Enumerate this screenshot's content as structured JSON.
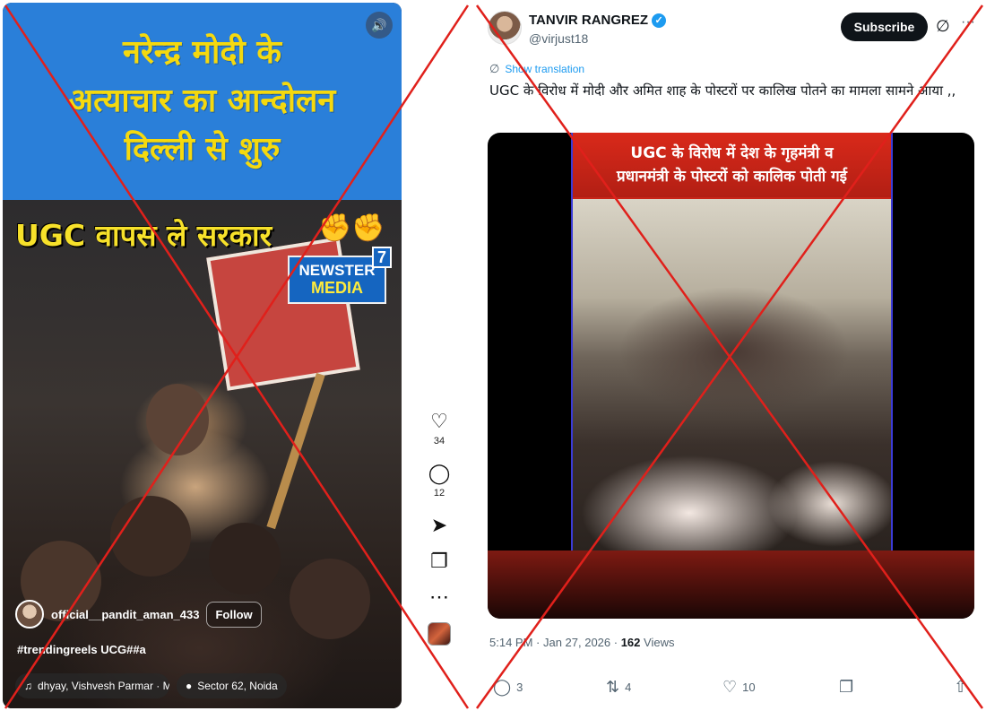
{
  "reel": {
    "banner_lines": [
      "नरेन्द्र मोदी के",
      "अत्याचार का आन्दोलन",
      "दिल्ली से शुरु"
    ],
    "video_caption": "UGC  वापस ले सरकार",
    "watermark": {
      "line1": "NEWSTER",
      "line2": "MEDIA",
      "badge": "7"
    },
    "username": "official__pandit_aman_433",
    "follow_label": "Follow",
    "caption": "#trendingreels UCG##a",
    "audio_chip": "dhyay, Vishvesh Parmar · M",
    "location_chip": "Sector 62, Noida",
    "rail": {
      "likes": "34",
      "comments": "12"
    }
  },
  "tweet": {
    "display_name": "TANVIR RANGREZ",
    "handle": "@virjust18",
    "subscribe_label": "Subscribe",
    "show_translation": "Show translation",
    "text": "UGC के विरोध में मोदी और अमित शाह के पोस्टरों पर कालिख पोतने का मामला सामने आया ,,",
    "media_headline": [
      "UGC के विरोध में देश के गृहमंत्री व",
      "प्रधानमंत्री के पोस्टरों को कालिक पोती गई"
    ],
    "timestamp": "5:14 PM · Jan 27, 2026 · ",
    "views_count": "162",
    "views_label": " Views",
    "actions": {
      "replies": "3",
      "reposts": "4",
      "likes": "10"
    }
  },
  "colors": {
    "banner_blue": "#2a7fd9",
    "banner_text_yellow": "#f5d90e",
    "cross_red": "#e0201b",
    "x_blue": "#1d9bf0"
  }
}
